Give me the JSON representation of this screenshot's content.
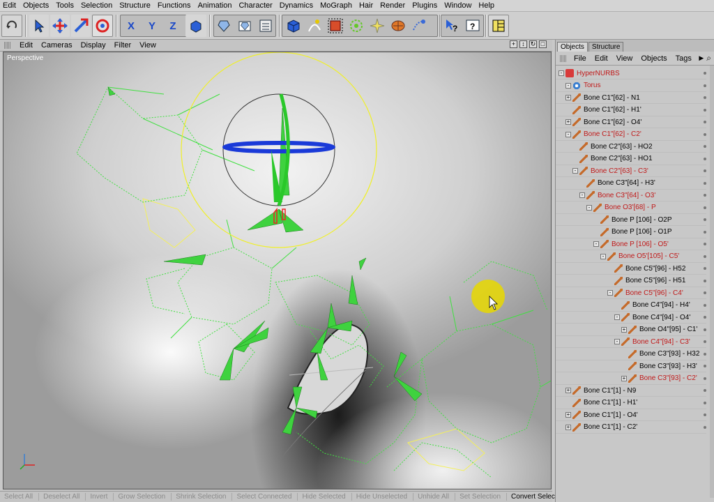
{
  "menubar": {
    "items": [
      "Edit",
      "Objects",
      "Tools",
      "Selection",
      "Structure",
      "Functions",
      "Animation",
      "Character",
      "Dynamics",
      "MoGraph",
      "Hair",
      "Render",
      "Plugins",
      "Window",
      "Help"
    ]
  },
  "toolbar": {
    "axis_x": "X",
    "axis_y": "Y",
    "axis_z": "Z",
    "icons": [
      "undo-icon",
      "pointer-icon",
      "move-icon",
      "scale-icon",
      "rotate-icon",
      "x-axis-icon",
      "y-axis-icon",
      "z-axis-icon",
      "coord-system-icon",
      "render-view-icon",
      "render-picture-icon",
      "render-settings-icon",
      "cube-icon",
      "pen-spline-icon",
      "subdivision-icon",
      "array-icon",
      "deformer-icon",
      "scene-icon",
      "camera-icon",
      "help-icon",
      "info-icon",
      "layout-icon"
    ]
  },
  "viewport": {
    "menu": [
      "Edit",
      "Cameras",
      "Display",
      "Filter",
      "View"
    ],
    "label": "Perspective",
    "ctrl_icons": [
      "move-view-icon",
      "zoom-view-icon",
      "rotate-view-icon",
      "maximize-view-icon"
    ]
  },
  "footer": {
    "items": [
      "Select All",
      "Deselect All",
      "Invert",
      "Grow Selection",
      "Shrink Selection",
      "Select Connected",
      "Hide Selected",
      "Hide Unselected",
      "Unhide All",
      "Set Selection",
      "Convert Selection"
    ],
    "active": "Convert Selection"
  },
  "object_manager": {
    "tabs": [
      "Objects",
      "Structure"
    ],
    "active_tab": "Objects",
    "menu": [
      "File",
      "Edit",
      "View",
      "Objects",
      "Tags"
    ],
    "tree": [
      {
        "label": "HyperNURBS",
        "depth": 0,
        "expander": "-",
        "icon": "hypernurbs-icon",
        "red": true
      },
      {
        "label": "Torus",
        "depth": 1,
        "expander": "-",
        "icon": "torus-icon",
        "red": true
      },
      {
        "label": "Bone C1\"[62] - N1",
        "depth": 1,
        "expander": "+",
        "icon": "bone-icon",
        "red": false
      },
      {
        "label": "Bone C1\"[62] - H1'",
        "depth": 1,
        "expander": "",
        "icon": "bone-icon",
        "red": false
      },
      {
        "label": "Bone C1\"[62] - O4'",
        "depth": 1,
        "expander": "+",
        "icon": "bone-icon",
        "red": false
      },
      {
        "label": "Bone C1\"[62] - C2'",
        "depth": 1,
        "expander": "-",
        "icon": "bone-icon",
        "red": true
      },
      {
        "label": "Bone C2\"[63] - HO2",
        "depth": 2,
        "expander": "",
        "icon": "bone-icon",
        "red": false
      },
      {
        "label": "Bone C2\"[63] - HO1",
        "depth": 2,
        "expander": "",
        "icon": "bone-icon",
        "red": false
      },
      {
        "label": "Bone C2\"[63] - C3'",
        "depth": 2,
        "expander": "-",
        "icon": "bone-icon",
        "red": true
      },
      {
        "label": "Bone C3\"[64] - H3'",
        "depth": 3,
        "expander": "",
        "icon": "bone-icon",
        "red": false
      },
      {
        "label": "Bone C3\"[64] - O3'",
        "depth": 3,
        "expander": "-",
        "icon": "bone-icon",
        "red": true
      },
      {
        "label": "Bone O3'[68] - P",
        "depth": 4,
        "expander": "-",
        "icon": "bone-icon",
        "red": true
      },
      {
        "label": "Bone P [106] - O2P",
        "depth": 5,
        "expander": "",
        "icon": "bone-icon",
        "red": false
      },
      {
        "label": "Bone P [106] - O1P",
        "depth": 5,
        "expander": "",
        "icon": "bone-icon",
        "red": false
      },
      {
        "label": "Bone P [106] - O5'",
        "depth": 5,
        "expander": "-",
        "icon": "bone-icon",
        "red": true
      },
      {
        "label": "Bone O5'[105] - C5'",
        "depth": 6,
        "expander": "-",
        "icon": "bone-icon",
        "red": true
      },
      {
        "label": "Bone C5\"[96] - H52",
        "depth": 7,
        "expander": "",
        "icon": "bone-icon",
        "red": false
      },
      {
        "label": "Bone C5\"[96] - H51",
        "depth": 7,
        "expander": "",
        "icon": "bone-icon",
        "red": false
      },
      {
        "label": "Bone C5\"[96] - C4'",
        "depth": 7,
        "expander": "-",
        "icon": "bone-icon",
        "red": true
      },
      {
        "label": "Bone C4\"[94] - H4'",
        "depth": 8,
        "expander": "",
        "icon": "bone-icon",
        "red": false
      },
      {
        "label": "Bone C4\"[94] - O4'",
        "depth": 8,
        "expander": "-",
        "icon": "bone-icon",
        "red": false
      },
      {
        "label": "Bone O4\"[95] - C1'",
        "depth": 9,
        "expander": "+",
        "icon": "bone-icon",
        "red": false
      },
      {
        "label": "Bone C4\"[94] - C3'",
        "depth": 8,
        "expander": "-",
        "icon": "bone-icon",
        "red": true
      },
      {
        "label": "Bone C3\"[93] - H32",
        "depth": 9,
        "expander": "",
        "icon": "bone-icon",
        "red": false
      },
      {
        "label": "Bone C3\"[93] - H3'",
        "depth": 9,
        "expander": "",
        "icon": "bone-icon",
        "red": false
      },
      {
        "label": "Bone C3\"[93] - C2'",
        "depth": 9,
        "expander": "+",
        "icon": "bone-icon",
        "red": true
      },
      {
        "label": "Bone C1\"[1] - N9",
        "depth": 1,
        "expander": "+",
        "icon": "bone-icon",
        "red": false
      },
      {
        "label": "Bone C1\"[1] - H1'",
        "depth": 1,
        "expander": "",
        "icon": "bone-icon",
        "red": false
      },
      {
        "label": "Bone C1\"[1] - O4'",
        "depth": 1,
        "expander": "+",
        "icon": "bone-icon",
        "red": false
      },
      {
        "label": "Bone C1\"[1] - C2'",
        "depth": 1,
        "expander": "+",
        "icon": "bone-icon",
        "red": false
      }
    ]
  },
  "colors": {
    "selected_bone": "#c01818",
    "bone_wire": "#40e040",
    "highlight_wire": "#f4f05a",
    "cursor_highlight": "#e8d800"
  }
}
